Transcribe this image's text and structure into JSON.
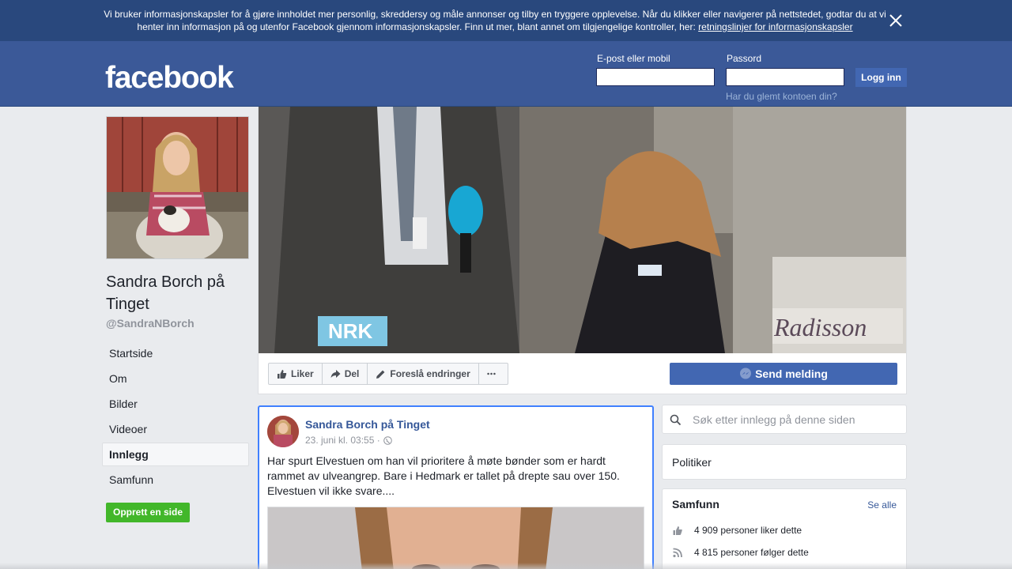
{
  "cookie_banner": {
    "text": "Vi bruker informasjonskapsler for å gjøre innholdet mer personlig, skreddersy og måle annonser og tilby en tryggere opplevelse. Når du klikker eller navigerer på nettstedet, godtar du at vi henter inn informasjon på og utenfor Facebook gjennom informasjonskapsler. Finn ut mer, blant annet om tilgjengelige kontroller, her:",
    "link": "retningslinjer for informasjonskapsler",
    "close_icon": "close-icon"
  },
  "header": {
    "logo": "facebook",
    "email_label": "E-post eller mobil",
    "email_value": "",
    "password_label": "Passord",
    "password_value": "",
    "login_button": "Logg inn",
    "forgot_link": "Har du glemt kontoen din?"
  },
  "page": {
    "name": "Sandra Borch på Tinget",
    "handle": "@SandraNBorch",
    "nav": [
      {
        "label": "Startside",
        "active": false
      },
      {
        "label": "Om",
        "active": false
      },
      {
        "label": "Bilder",
        "active": false
      },
      {
        "label": "Videoer",
        "active": false
      },
      {
        "label": "Innlegg",
        "active": true
      },
      {
        "label": "Samfunn",
        "active": false
      }
    ],
    "create_page_button": "Opprett en side"
  },
  "actions": {
    "like": "Liker",
    "share": "Del",
    "suggest": "Foreslå endringer",
    "more_icon": "more-icon",
    "send_message": "Send melding"
  },
  "post": {
    "author": "Sandra Borch på Tinget",
    "time": "23. juni kl. 03:55 ·",
    "privacy_icon": "globe-icon",
    "text": "Har spurt Elvestuen om han vil prioritere å møte bønder som er hardt rammet av ulveangrep. Bare i Hedmark er tallet på drepte sau over 150. Elvestuen vil ikke svare...."
  },
  "sidebar": {
    "search_placeholder": "Søk etter innlegg på denne siden",
    "category": "Politiker",
    "community": {
      "title": "Samfunn",
      "see_all": "Se alle",
      "likes": "4 909 personer liker dette",
      "follows": "4 815 personer følger dette"
    }
  },
  "colors": {
    "brand": "#3b5998",
    "banner": "#29487d",
    "button": "#4267b2",
    "create_green": "#42b72a",
    "link": "#365899"
  }
}
